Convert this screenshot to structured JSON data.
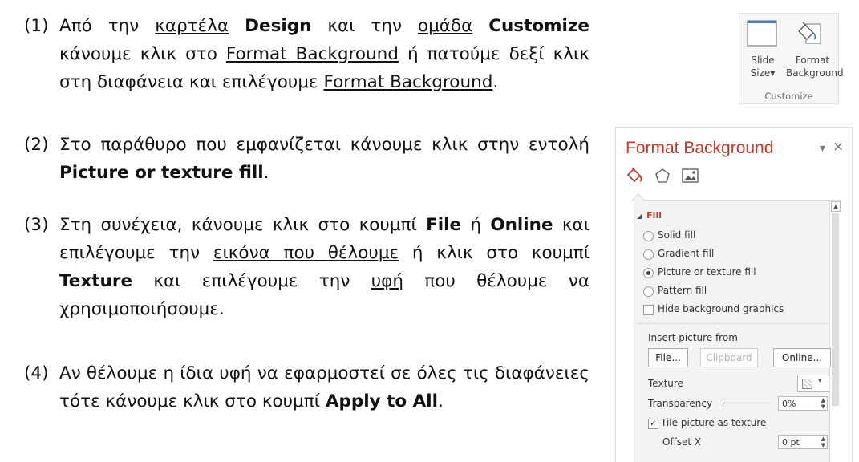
{
  "steps": [
    {
      "num": "(1)",
      "parts": [
        {
          "t": "Από την "
        },
        {
          "t": "καρτέλα",
          "u": true
        },
        {
          "t": " "
        },
        {
          "t": "Design",
          "b": true
        },
        {
          "t": " και την "
        },
        {
          "t": "ομάδα",
          "u": true
        },
        {
          "t": " "
        },
        {
          "t": "Customize",
          "b": true
        },
        {
          "t": " κάνουμε κλικ στο "
        },
        {
          "t": "Format Background",
          "u": true
        },
        {
          "t": " ή πατούμε δεξί κλικ στη διαφάνεια και επιλέγουμε "
        },
        {
          "t": "Format Background",
          "u": true
        },
        {
          "t": "."
        }
      ]
    },
    {
      "num": "(2)",
      "parts": [
        {
          "t": "Στο παράθυρο που εμφανίζεται κάνουμε κλικ στην εντολή "
        },
        {
          "t": "Picture or texture fill",
          "b": true
        },
        {
          "t": "."
        }
      ]
    },
    {
      "num": "(3)",
      "parts": [
        {
          "t": "Στη συνέχεια, κάνουμε κλικ στο κουμπί "
        },
        {
          "t": "File",
          "b": true
        },
        {
          "t": " ή "
        },
        {
          "t": "Online",
          "b": true
        },
        {
          "t": " και επιλέγουμε την "
        },
        {
          "t": "εικόνα που θέλουμε",
          "u": true
        },
        {
          "t": " ή κλικ στο κουμπί "
        },
        {
          "t": "Texture",
          "b": true
        },
        {
          "t": " και επιλέγουμε την "
        },
        {
          "t": "υφή",
          "u": true
        },
        {
          "t": " που θέλουμε να χρησιμοποιήσουμε."
        }
      ]
    },
    {
      "num": "(4)",
      "parts": [
        {
          "t": "Αν θέλουμε η ίδια υφή να εφαρμοστεί σε όλες τις διαφάνειες τότε κάνουμε κλικ στο κουμπί "
        },
        {
          "t": "Apply to All",
          "b": true
        },
        {
          "t": "."
        }
      ]
    }
  ],
  "ribbon": {
    "slide_size_line1": "Slide",
    "slide_size_line2": "Size",
    "slide_size_arrow": "▾",
    "format_bg_line1": "Format",
    "format_bg_line2": "Background",
    "group_label": "Customize",
    "icons": [
      "slide-size-icon",
      "format-background-icon"
    ]
  },
  "pane": {
    "title": "Format Background",
    "options_arrow": "▾",
    "close": "×",
    "tabs": [
      "fill-icon",
      "effects-icon",
      "picture-icon"
    ],
    "section_toggle": "◢",
    "section_label": "Fill",
    "fill_options": [
      {
        "label": "Solid fill",
        "selected": false
      },
      {
        "label": "Gradient fill",
        "selected": false
      },
      {
        "label": "Picture or texture fill",
        "selected": true
      },
      {
        "label": "Pattern fill",
        "selected": false
      }
    ],
    "hide_bg_label": "Hide background graphics",
    "hide_bg_checked": false,
    "insert_from_label": "Insert picture from",
    "btn_file": "File...",
    "btn_clipboard": "Clipboard",
    "btn_online": "Online...",
    "texture_label": "Texture",
    "transparency_label": "Transparency",
    "transparency_value": "0%",
    "tile_label": "Tile picture as texture",
    "tile_checked": true,
    "offset_x_label": "Offset X",
    "offset_x_value": "0 pt",
    "colors": {
      "accent": "#c0392b"
    }
  }
}
